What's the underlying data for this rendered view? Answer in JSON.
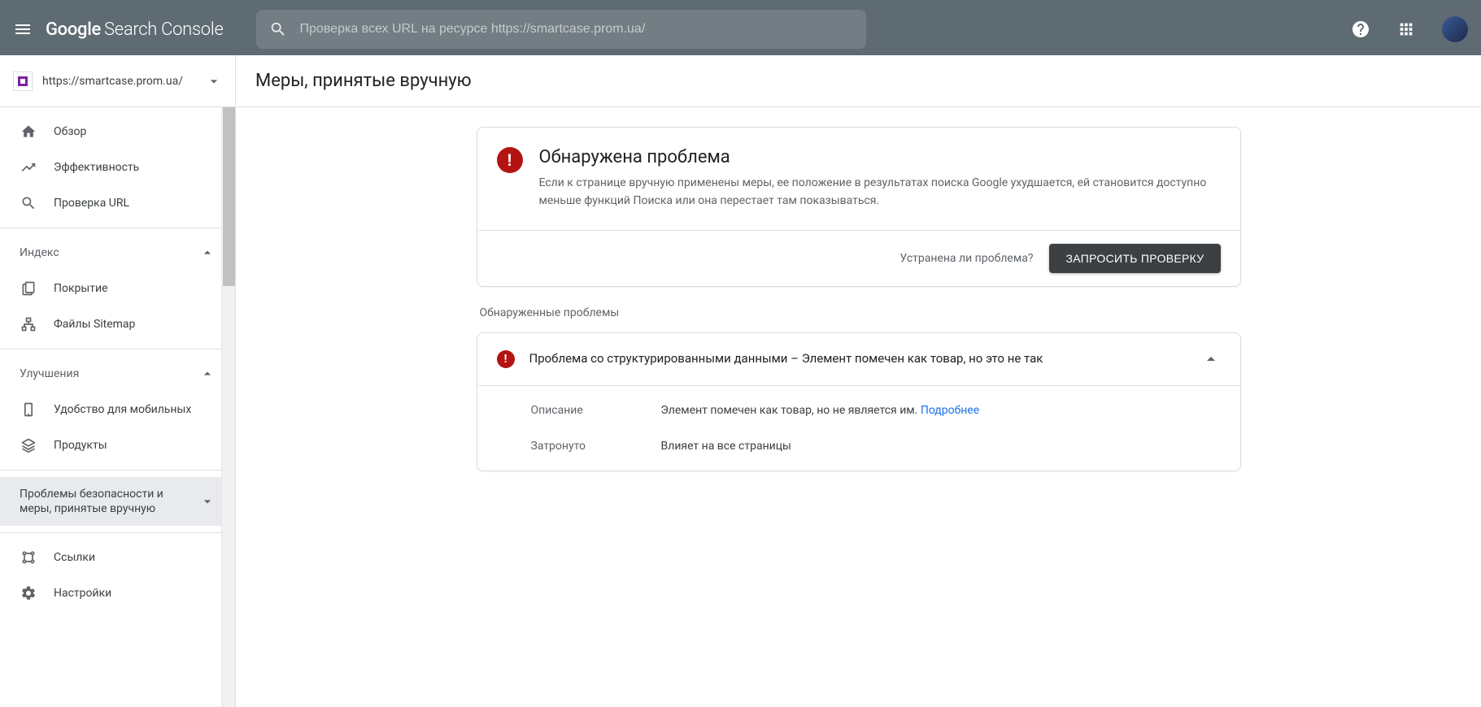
{
  "header": {
    "logo_google": "Google",
    "logo_rest": "Search Console",
    "search_placeholder": "Проверка всех URL на ресурсе https://smartcase.prom.ua/"
  },
  "sidebar": {
    "property_url": "https://smartcase.prom.ua/",
    "items": {
      "overview": "Обзор",
      "performance": "Эффективность",
      "url_inspection": "Проверка URL"
    },
    "section_index": "Индекс",
    "items_index": {
      "coverage": "Покрытие",
      "sitemaps": "Файлы Sitemap"
    },
    "section_enhancements": "Улучшения",
    "items_enhancements": {
      "mobile_usability": "Удобство для мобильных",
      "products": "Продукты"
    },
    "security_manual": "Проблемы безопасности и меры, принятые вручную",
    "links": "Ссылки",
    "settings": "Настройки"
  },
  "content": {
    "page_title": "Меры, принятые вручную",
    "alert": {
      "title": "Обнаружена проблема",
      "description": "Если к странице вручную применены меры, ее положение в результатах поиска Google ухудшается, ей становится доступно меньше функций Поиска или она перестает там показываться.",
      "footer_question": "Устранена ли проблема?",
      "footer_button": "ЗАПРОСИТЬ ПРОВЕРКУ"
    },
    "issues_label": "Обнаруженные проблемы",
    "issue": {
      "title": "Проблема со структурированными данными – Элемент помечен как товар, но это не так",
      "row1_label": "Описание",
      "row1_value": "Элемент помечен как товар, но не является им. ",
      "row1_link": "Подробнее",
      "row2_label": "Затронуто",
      "row2_value": "Влияет на все страницы"
    }
  }
}
